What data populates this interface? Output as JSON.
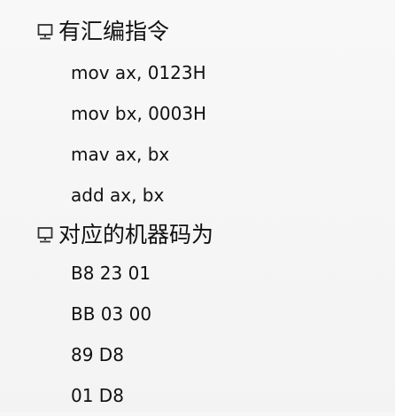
{
  "sections": [
    {
      "title": "有汇编指令",
      "items": [
        "mov ax, 0123H",
        "mov bx, 0003H",
        "mav ax, bx",
        "add ax, bx"
      ]
    },
    {
      "title": "对应的机器码为",
      "items": [
        "B8 23 01",
        "BB 03 00",
        "89 D8",
        "01 D8"
      ]
    }
  ],
  "bullet_icon": "monitor-icon",
  "colors": {
    "background": "#f6f6f6",
    "text": "#111111",
    "bullet": "#333333"
  }
}
